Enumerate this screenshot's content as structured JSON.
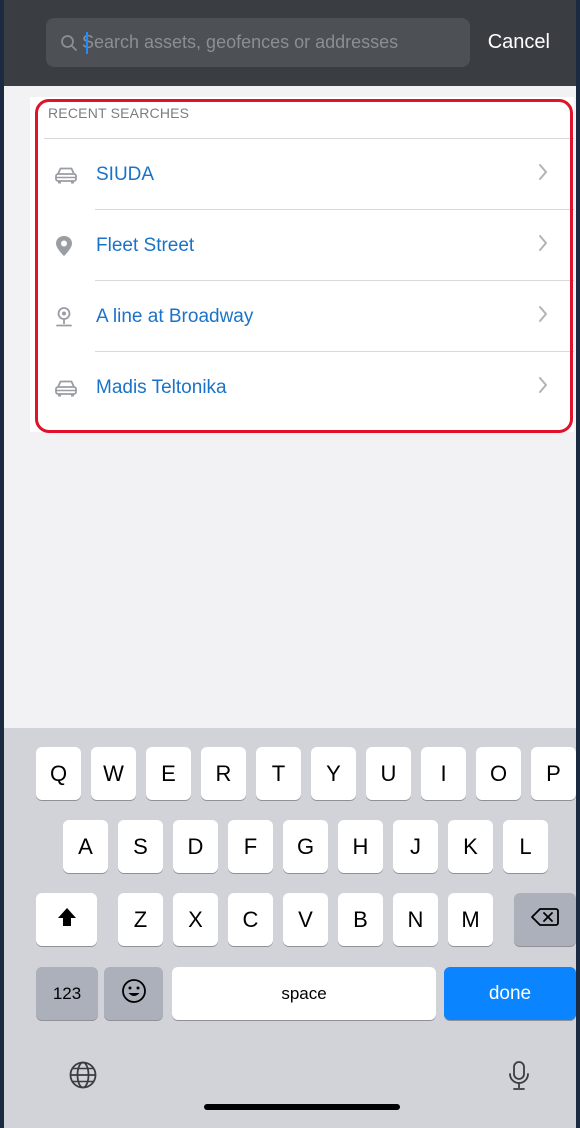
{
  "search": {
    "placeholder": "Search assets, geofences or addresses",
    "value": "",
    "cancel_label": "Cancel"
  },
  "recent": {
    "header": "RECENT SEARCHES",
    "items": [
      {
        "label": "SIUDA",
        "icon": "car-icon"
      },
      {
        "label": "Fleet Street",
        "icon": "location-pin-icon"
      },
      {
        "label": "A line at Broadway",
        "icon": "geofence-pin-icon"
      },
      {
        "label": "Madis Teltonika",
        "icon": "car-icon"
      }
    ]
  },
  "keyboard": {
    "row1": [
      "Q",
      "W",
      "E",
      "R",
      "T",
      "Y",
      "U",
      "I",
      "O",
      "P"
    ],
    "row2": [
      "A",
      "S",
      "D",
      "F",
      "G",
      "H",
      "J",
      "K",
      "L"
    ],
    "row3": [
      "Z",
      "X",
      "C",
      "V",
      "B",
      "N",
      "M"
    ],
    "numbers_label": "123",
    "space_label": "space",
    "done_label": "done"
  },
  "colors": {
    "accent": "#1a73c9",
    "highlight_outline": "#e0112b",
    "done_key": "#0a84ff",
    "topbar": "#3a3d42"
  }
}
